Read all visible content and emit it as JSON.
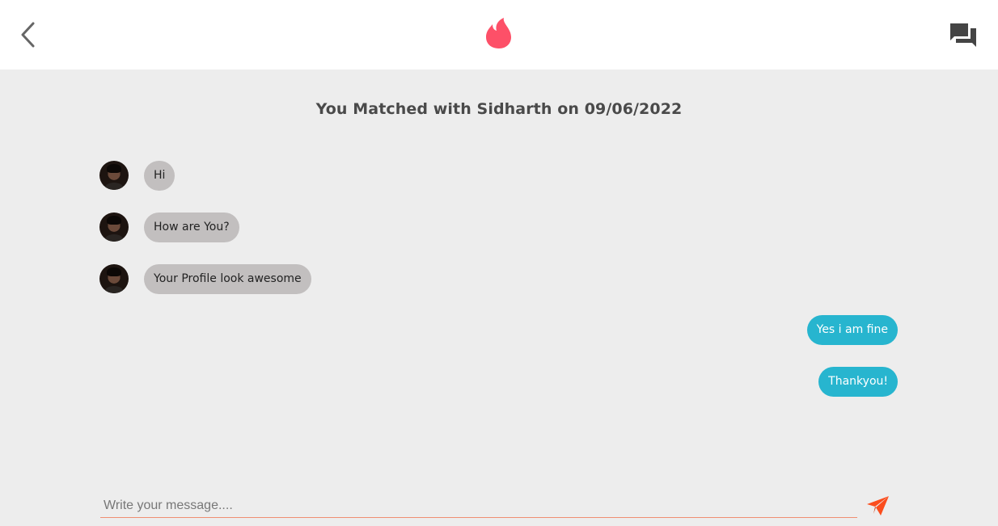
{
  "header": {
    "back_icon": "chevron-left-icon",
    "logo_icon": "flame-icon",
    "chat_icon": "forum-icon",
    "accent_color": "#fd5068"
  },
  "match_banner": "You Matched with Sidharth on 09/06/2022",
  "messages_received": [
    {
      "text": "Hi"
    },
    {
      "text": "How are You?"
    },
    {
      "text": "Your Profile look awesome"
    }
  ],
  "messages_sent": [
    {
      "text": "Yes i am fine"
    },
    {
      "text": "Thankyou!"
    }
  ],
  "composer": {
    "placeholder": "Write your message....",
    "value": "",
    "send_icon": "paper-plane-icon",
    "send_color": "#fb4d1d"
  },
  "colors": {
    "received_bubble": "#c2bfbf",
    "sent_bubble": "#27b5cf",
    "background": "#ededed"
  }
}
